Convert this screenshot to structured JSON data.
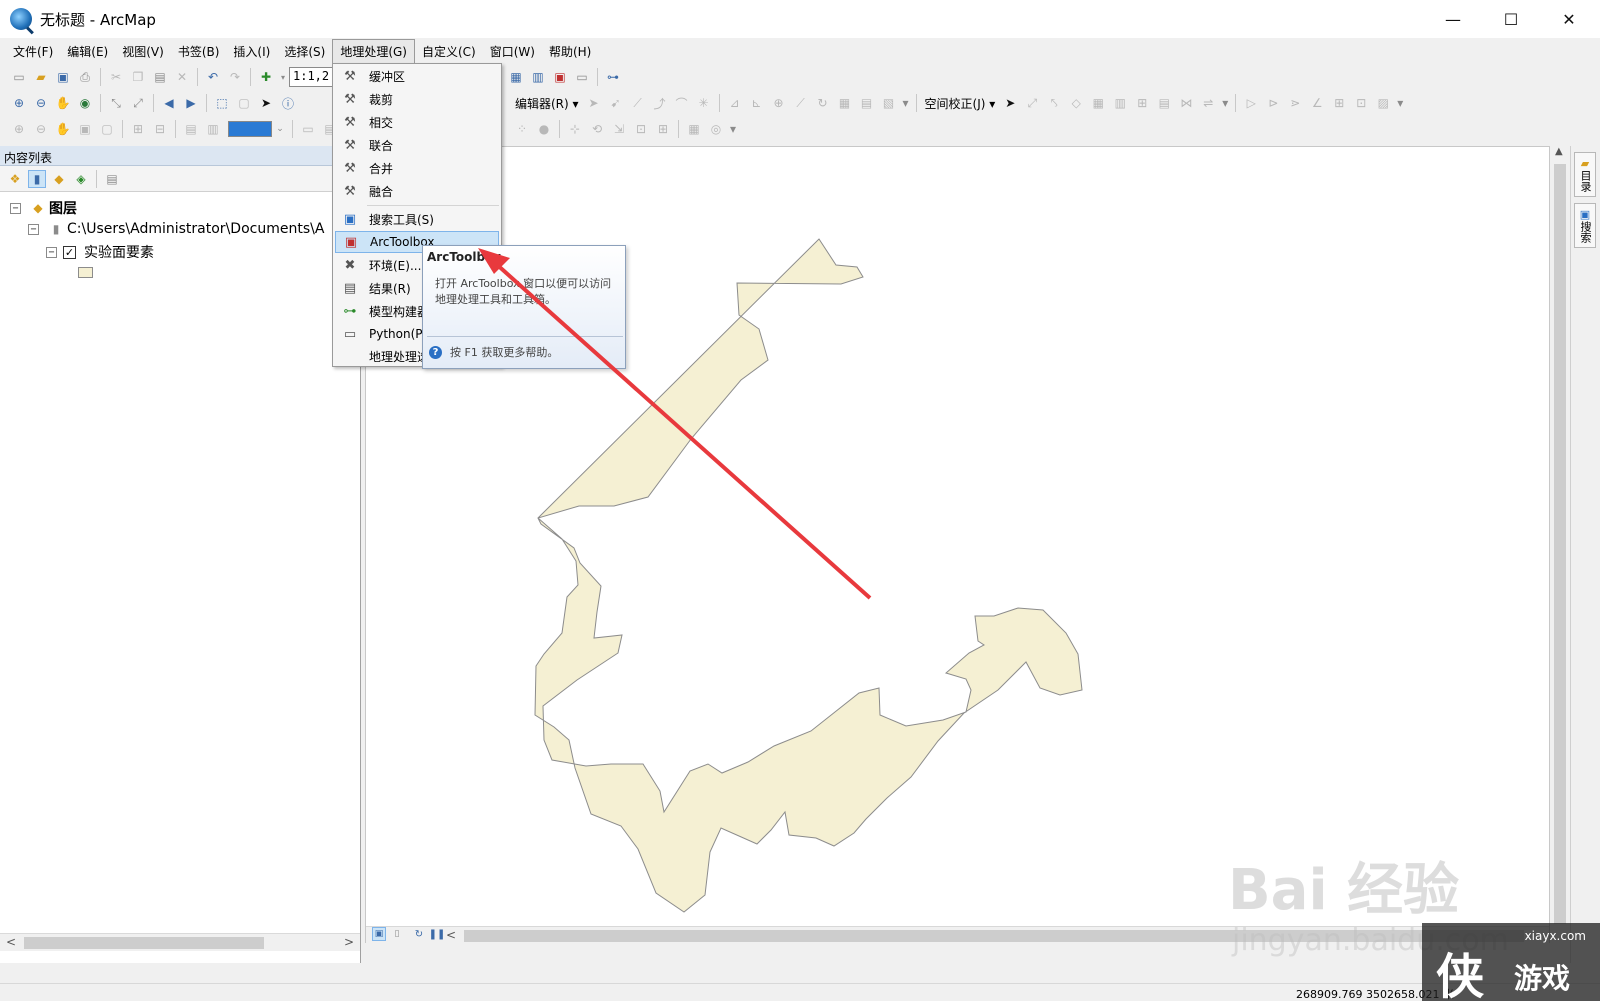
{
  "window": {
    "title": "无标题 - ArcMap",
    "minimize": "—",
    "maximize": "☐",
    "close": "✕"
  },
  "menubar": {
    "items": [
      "文件(F)",
      "编辑(E)",
      "视图(V)",
      "书签(B)",
      "插入(I)",
      "选择(S)",
      "地理处理(G)",
      "自定义(C)",
      "窗口(W)",
      "帮助(H)"
    ]
  },
  "toolbar": {
    "scale_value": "1:1,2",
    "editor_label": "编辑器(R) ▾",
    "spatial_adjust_label": "空间校正(J) ▾"
  },
  "toc": {
    "title": "内容列表",
    "layers_label": "图层",
    "path_label": "C:\\Users\\Administrator\\Documents\\A",
    "feature_label": "实验面要素",
    "checked": "✓"
  },
  "geoprocessing_menu": {
    "items": [
      "缓冲区",
      "裁剪",
      "相交",
      "联合",
      "合并",
      "融合",
      "搜索工具(S)",
      "ArcToolbox",
      "环境(E)...",
      "结果(R)",
      "模型构建器",
      "Python(P",
      "地理处理选"
    ]
  },
  "tooltip": {
    "title": "ArcToolbox",
    "body": "打开 ArcToolbox 窗口以便可以访问地理处理工具和工具箱。",
    "help": "按 F1 获取更多帮助。",
    "help_icon": "?"
  },
  "dock": {
    "catalog": "目录",
    "search": "搜索"
  },
  "status": {
    "coordinates": "268909.769  3502658.021 米"
  },
  "watermark": {
    "baidu": "Bai 经验",
    "baidu_url": "jingyan.baidu.com",
    "site": "xiayx.com",
    "logo_big": "侠",
    "logo_small": "游戏"
  },
  "colors": {
    "polygon_fill": "#f5f0d3",
    "polygon_stroke": "#8c8c8c",
    "arrow": "#e8393d",
    "menu_selected": "#cce4f7"
  }
}
